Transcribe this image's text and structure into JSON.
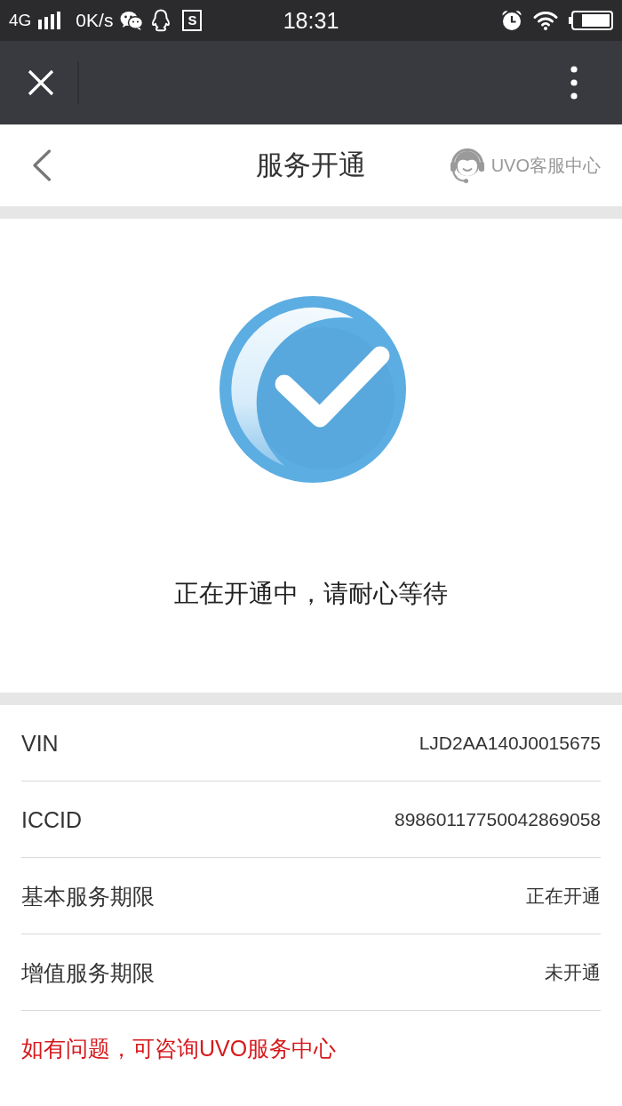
{
  "status_bar": {
    "network_type": "4G",
    "data_speed": "0K/s",
    "app_icon_letter": "S",
    "time": "18:31"
  },
  "header": {
    "title": "服务开通",
    "service_link": "UVO客服中心"
  },
  "activation": {
    "message": "正在开通中，请耐心等待"
  },
  "info_rows": [
    {
      "label": "VIN",
      "value": "LJD2AA140J0015675"
    },
    {
      "label": "ICCID",
      "value": "89860117750042869058"
    },
    {
      "label": "基本服务期限",
      "value": "正在开通"
    },
    {
      "label": "增值服务期限",
      "value": "未开通"
    }
  ],
  "notice": "如有问题，可咨询UVO服务中心"
}
